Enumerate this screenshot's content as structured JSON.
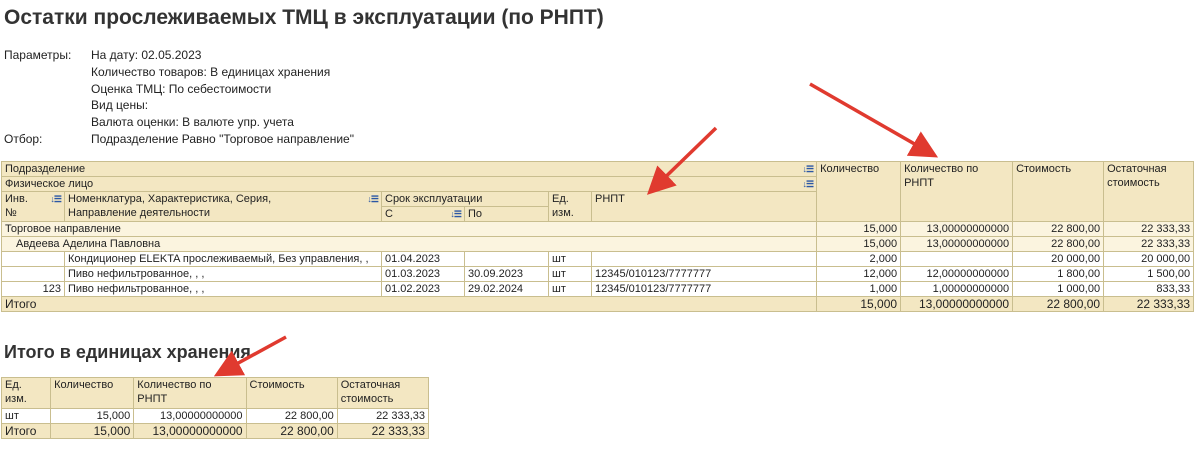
{
  "title": "Остатки прослеживаемых ТМЦ в эксплуатации (по РНПТ)",
  "params": [
    {
      "label": "Параметры:",
      "value": "На дату: 02.05.2023"
    },
    {
      "label": "",
      "value": "Количество товаров: В единицах хранения"
    },
    {
      "label": "",
      "value": "Оценка ТМЦ: По себестоимости"
    },
    {
      "label": "",
      "value": "Вид цены:"
    },
    {
      "label": "",
      "value": "Валюта оценки: В валюте упр. учета"
    },
    {
      "label": "Отбор:",
      "value": "Подразделение Равно \"Торговое направление\""
    }
  ],
  "main": {
    "h_subdivision": "Подразделение",
    "h_person": "Физическое лицо",
    "h_inv_1": "Инв.",
    "h_inv_2": "№",
    "h_nom_1": "Номенклатура, Характеристика, Серия,",
    "h_nom_2": "Направление деятельности",
    "h_period": "Срок эксплуатации",
    "h_from": "С",
    "h_to": "По",
    "h_unit_1": "Ед.",
    "h_unit_2": "изм.",
    "h_rnpt": "РНПТ",
    "h_qty": "Количество",
    "h_qty_rnpt_1": "Количество по",
    "h_qty_rnpt_2": "РНПТ",
    "h_cost": "Стоимость",
    "h_resid_1": "Остаточная",
    "h_resid_2": "стоимость",
    "group1": {
      "name": "Торговое направление",
      "qty": "15,000",
      "qty_rnpt": "13,00000000000",
      "cost": "22 800,00",
      "resid": "22 333,33"
    },
    "group2": {
      "name": "Авдеева Аделина Павловна",
      "qty": "15,000",
      "qty_rnpt": "13,00000000000",
      "cost": "22 800,00",
      "resid": "22 333,33"
    },
    "rows": [
      {
        "inv": "",
        "nom": "Кондиционер ELEKTA прослеживаемый, Без управления, ,",
        "from": "01.04.2023",
        "to": "",
        "unit": "шт",
        "rnpt": "",
        "qty": "2,000",
        "qty_rnpt": "",
        "cost": "20 000,00",
        "resid": "20 000,00"
      },
      {
        "inv": "",
        "nom": "Пиво нефильтрованное, , ,",
        "from": "01.03.2023",
        "to": "30.09.2023",
        "unit": "шт",
        "rnpt": "12345/010123/7777777",
        "qty": "12,000",
        "qty_rnpt": "12,00000000000",
        "cost": "1 800,00",
        "resid": "1 500,00"
      },
      {
        "inv": "123",
        "nom": "Пиво нефильтрованное, , ,",
        "from": "01.02.2023",
        "to": "29.02.2024",
        "unit": "шт",
        "rnpt": "12345/010123/7777777",
        "qty": "1,000",
        "qty_rnpt": "1,00000000000",
        "cost": "1 000,00",
        "resid": "833,33"
      }
    ],
    "total": {
      "label": "Итого",
      "qty": "15,000",
      "qty_rnpt": "13,00000000000",
      "cost": "22 800,00",
      "resid": "22 333,33"
    }
  },
  "section2_title": "Итого в единицах хранения",
  "sub": {
    "h_unit_1": "Ед.",
    "h_unit_2": "изм.",
    "h_qty": "Количество",
    "h_qty_rnpt_1": "Количество по",
    "h_qty_rnpt_2": "РНПТ",
    "h_cost": "Стоимость",
    "h_resid_1": "Остаточная",
    "h_resid_2": "стоимость",
    "row": {
      "unit": "шт",
      "qty": "15,000",
      "qty_rnpt": "13,00000000000",
      "cost": "22 800,00",
      "resid": "22 333,33"
    },
    "total": {
      "label": "Итого",
      "qty": "15,000",
      "qty_rnpt": "13,00000000000",
      "cost": "22 800,00",
      "resid": "22 333,33"
    }
  },
  "sort_icon": "sort-arrows-icon",
  "arrow_color": "#e03a2f",
  "accent_header": "#f3e7c2"
}
